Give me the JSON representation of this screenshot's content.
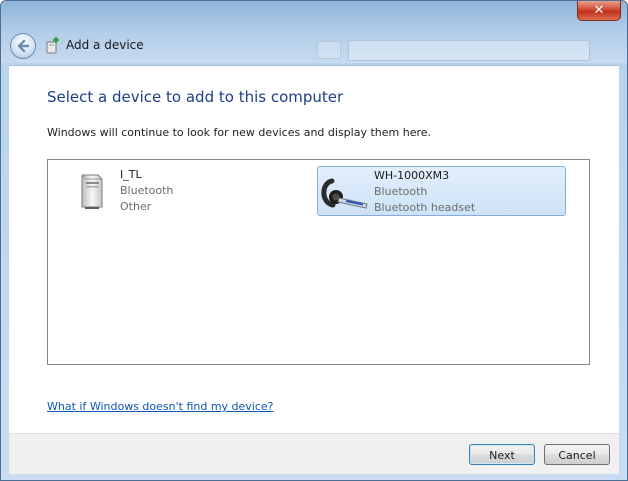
{
  "window": {
    "title": "Add a device",
    "close_label": "✕"
  },
  "icons": {
    "back": "back-arrow-icon",
    "wizard": "add-device-icon",
    "generic_device": "generic-device-icon",
    "headset": "bluetooth-headset-icon"
  },
  "main": {
    "heading": "Select a device to add to this computer",
    "subtext": "Windows will continue to look for new devices and display them here.",
    "devices": [
      {
        "name": "I_TL",
        "type": "Bluetooth",
        "category": "Other",
        "selected": false
      },
      {
        "name": "WH-1000XM3",
        "type": "Bluetooth",
        "category": "Bluetooth headset",
        "selected": true
      }
    ],
    "help_link": "What if Windows doesn't find my device?"
  },
  "footer": {
    "next_label": "Next",
    "cancel_label": "Cancel"
  },
  "colors": {
    "heading": "#1e3f8a",
    "link": "#0b56b6",
    "selection": "#cde2f8",
    "close_button": "#c0301c"
  }
}
